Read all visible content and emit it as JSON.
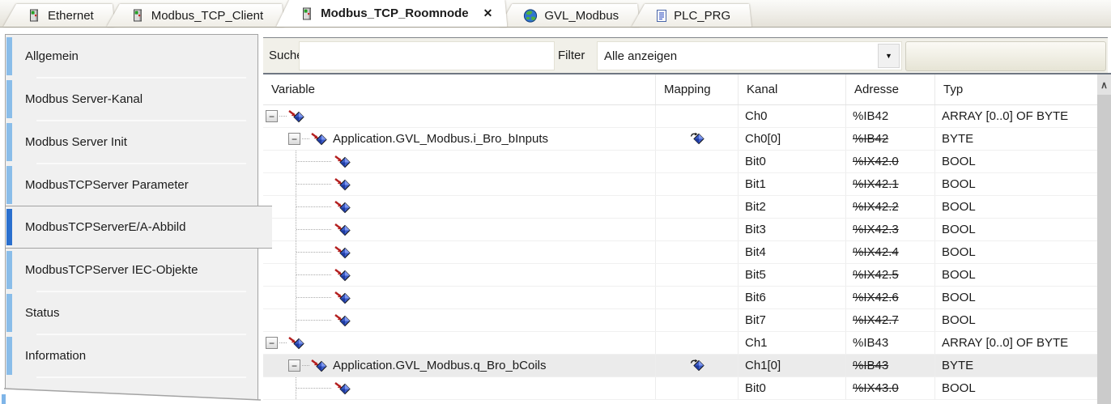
{
  "tabs": [
    {
      "label": "Ethernet",
      "icon": "device-icon",
      "active": false
    },
    {
      "label": "Modbus_TCP_Client",
      "icon": "device-icon",
      "active": false
    },
    {
      "label": "Modbus_TCP_Roomnode",
      "icon": "device-icon",
      "active": true,
      "close_glyph": "✕"
    },
    {
      "label": "GVL_Modbus",
      "icon": "globe-icon",
      "active": false
    },
    {
      "label": "PLC_PRG",
      "icon": "document-icon",
      "active": false
    }
  ],
  "sidebar": {
    "items": [
      {
        "label": "Allgemein",
        "selected": false
      },
      {
        "label": "Modbus Server-Kanal",
        "selected": false
      },
      {
        "label": "Modbus Server Init",
        "selected": false
      },
      {
        "label": "ModbusTCPServer Parameter",
        "selected": false
      },
      {
        "label": "ModbusTCPServerE/A-Abbild",
        "selected": true
      },
      {
        "label": "ModbusTCPServer IEC-Objekte",
        "selected": false
      },
      {
        "label": "Status",
        "selected": false
      },
      {
        "label": "Information",
        "selected": false
      }
    ]
  },
  "toolbar": {
    "search_label": "Suche",
    "search_value": "",
    "filter_label": "Filter",
    "filter_value": "Alle anzeigen",
    "dropdown_glyph": "▼"
  },
  "table": {
    "columns": [
      "Variable",
      "Mapping",
      "Kanal",
      "Adresse",
      "Typ"
    ],
    "collapse_glyph": "−",
    "scroll_up_glyph": "∧",
    "rows": [
      {
        "level": 0,
        "expander": true,
        "variable": "",
        "mapping": false,
        "kanal": "Ch0",
        "adresse": "%IB42",
        "struck": false,
        "typ": "ARRAY [0..0] OF BYTE",
        "selected": false
      },
      {
        "level": 1,
        "expander": true,
        "variable": "Application.GVL_Modbus.i_Bro_bInputs",
        "mapping": true,
        "kanal": "Ch0[0]",
        "adresse": "%IB42",
        "struck": true,
        "typ": "BYTE",
        "selected": false
      },
      {
        "level": 2,
        "expander": false,
        "variable": "",
        "mapping": false,
        "kanal": "Bit0",
        "adresse": "%IX42.0",
        "struck": true,
        "typ": "BOOL",
        "selected": false
      },
      {
        "level": 2,
        "expander": false,
        "variable": "",
        "mapping": false,
        "kanal": "Bit1",
        "adresse": "%IX42.1",
        "struck": true,
        "typ": "BOOL",
        "selected": false
      },
      {
        "level": 2,
        "expander": false,
        "variable": "",
        "mapping": false,
        "kanal": "Bit2",
        "adresse": "%IX42.2",
        "struck": true,
        "typ": "BOOL",
        "selected": false
      },
      {
        "level": 2,
        "expander": false,
        "variable": "",
        "mapping": false,
        "kanal": "Bit3",
        "adresse": "%IX42.3",
        "struck": true,
        "typ": "BOOL",
        "selected": false
      },
      {
        "level": 2,
        "expander": false,
        "variable": "",
        "mapping": false,
        "kanal": "Bit4",
        "adresse": "%IX42.4",
        "struck": true,
        "typ": "BOOL",
        "selected": false
      },
      {
        "level": 2,
        "expander": false,
        "variable": "",
        "mapping": false,
        "kanal": "Bit5",
        "adresse": "%IX42.5",
        "struck": true,
        "typ": "BOOL",
        "selected": false
      },
      {
        "level": 2,
        "expander": false,
        "variable": "",
        "mapping": false,
        "kanal": "Bit6",
        "adresse": "%IX42.6",
        "struck": true,
        "typ": "BOOL",
        "selected": false
      },
      {
        "level": 2,
        "expander": false,
        "variable": "",
        "mapping": false,
        "kanal": "Bit7",
        "adresse": "%IX42.7",
        "struck": true,
        "typ": "BOOL",
        "selected": false
      },
      {
        "level": 0,
        "expander": true,
        "variable": "",
        "mapping": false,
        "kanal": "Ch1",
        "adresse": "%IB43",
        "struck": false,
        "typ": "ARRAY [0..0] OF BYTE",
        "selected": false
      },
      {
        "level": 1,
        "expander": true,
        "variable": "Application.GVL_Modbus.q_Bro_bCoils",
        "mapping": true,
        "kanal": "Ch1[0]",
        "adresse": "%IB43",
        "struck": true,
        "typ": "BYTE",
        "selected": true
      },
      {
        "level": 2,
        "expander": false,
        "variable": "",
        "mapping": false,
        "kanal": "Bit0",
        "adresse": "%IX43.0",
        "struck": true,
        "typ": "BOOL",
        "selected": false
      }
    ]
  },
  "colors": {
    "selected_stripe": "#2a6fce",
    "item_stripe": "#8abde9",
    "row_highlight": "#ebebeb",
    "toolbar_bg": "#f1f0e9",
    "tabbar_bg": "#e5e2d9",
    "sidebar_bg": "#f0f0f0"
  }
}
